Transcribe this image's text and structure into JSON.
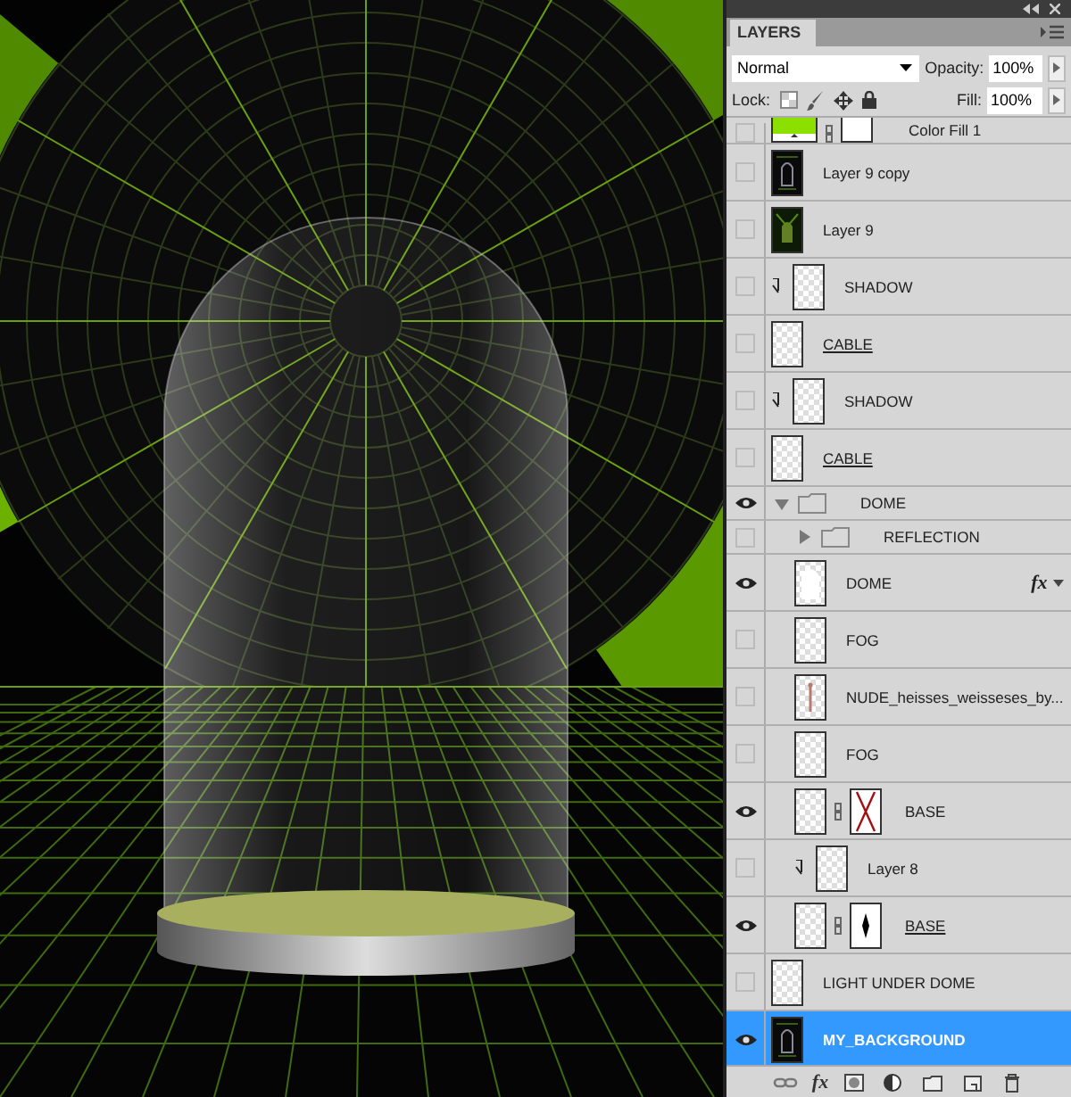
{
  "panel": {
    "title": "LAYERS",
    "blend_mode": "Normal",
    "opacity_label": "Opacity:",
    "opacity": "100%",
    "lock_label": "Lock:",
    "fill_label": "Fill:",
    "fill": "100%"
  },
  "layers": [
    {
      "name": "Color Fill 1",
      "kind": "fill",
      "visible": false,
      "selected": false,
      "clipped": false,
      "linked": false,
      "thumbnail": {
        "kind": "fill"
      },
      "mask": {
        "kind": "white"
      },
      "partial": true
    },
    {
      "name": "Layer 9 copy",
      "kind": "pixel",
      "visible": false,
      "selected": false,
      "clipped": false,
      "linked": false,
      "thumbnail": {
        "kind": "dark"
      }
    },
    {
      "name": "Layer 9",
      "kind": "pixel",
      "visible": false,
      "selected": false,
      "clipped": false,
      "linked": false,
      "thumbnail": {
        "kind": "figure_glow"
      }
    },
    {
      "name": "SHADOW",
      "kind": "pixel",
      "visible": false,
      "selected": false,
      "clipped": true,
      "linked": false,
      "thumbnail": {
        "kind": "transparent"
      }
    },
    {
      "name": "CABLE",
      "kind": "pixel",
      "visible": false,
      "selected": false,
      "clipped": false,
      "linked": true,
      "thumbnail": {
        "kind": "transparent"
      }
    },
    {
      "name": "SHADOW",
      "kind": "pixel",
      "visible": false,
      "selected": false,
      "clipped": true,
      "linked": false,
      "thumbnail": {
        "kind": "transparent"
      }
    },
    {
      "name": "CABLE",
      "kind": "pixel",
      "visible": false,
      "selected": false,
      "clipped": false,
      "linked": true,
      "thumbnail": {
        "kind": "transparent"
      }
    },
    {
      "name": "DOME",
      "kind": "group",
      "visible": true,
      "selected": false,
      "expanded": true,
      "children": [
        {
          "name": "REFLECTION",
          "kind": "group",
          "visible": false,
          "selected": false,
          "expanded": false
        },
        {
          "name": "DOME",
          "kind": "pixel",
          "visible": true,
          "selected": false,
          "clipped": false,
          "linked": false,
          "thumbnail": {
            "kind": "dome"
          },
          "effects": "fx"
        },
        {
          "name": "FOG",
          "kind": "pixel",
          "visible": false,
          "selected": false,
          "clipped": false,
          "linked": false,
          "thumbnail": {
            "kind": "transparent"
          }
        },
        {
          "name": "NUDE_heisses_weisseses_by...",
          "kind": "pixel",
          "visible": false,
          "selected": false,
          "clipped": false,
          "linked": false,
          "thumbnail": {
            "kind": "figure"
          }
        },
        {
          "name": "FOG",
          "kind": "pixel",
          "visible": false,
          "selected": false,
          "clipped": false,
          "linked": false,
          "thumbnail": {
            "kind": "transparent"
          }
        },
        {
          "name": "BASE",
          "kind": "pixel",
          "visible": true,
          "selected": false,
          "clipped": false,
          "linked": false,
          "thumbnail": {
            "kind": "transparent"
          },
          "mask": {
            "kind": "cross"
          }
        },
        {
          "name": "Layer 8",
          "kind": "pixel",
          "visible": false,
          "selected": false,
          "clipped": true,
          "linked": false,
          "thumbnail": {
            "kind": "transparent"
          }
        },
        {
          "name": "BASE",
          "kind": "pixel",
          "visible": true,
          "selected": false,
          "clipped": false,
          "linked": true,
          "thumbnail": {
            "kind": "transparent"
          },
          "mask": {
            "kind": "figure"
          }
        }
      ]
    },
    {
      "name": "LIGHT UNDER DOME",
      "kind": "pixel",
      "visible": false,
      "selected": false,
      "clipped": false,
      "linked": false,
      "thumbnail": {
        "kind": "transparent"
      }
    },
    {
      "name": "MY_BACKGROUND",
      "kind": "pixel",
      "visible": true,
      "selected": true,
      "clipped": false,
      "linked": false,
      "thumbnail": {
        "kind": "dark"
      }
    }
  ],
  "toolbar": {
    "effects_label": "fx"
  }
}
